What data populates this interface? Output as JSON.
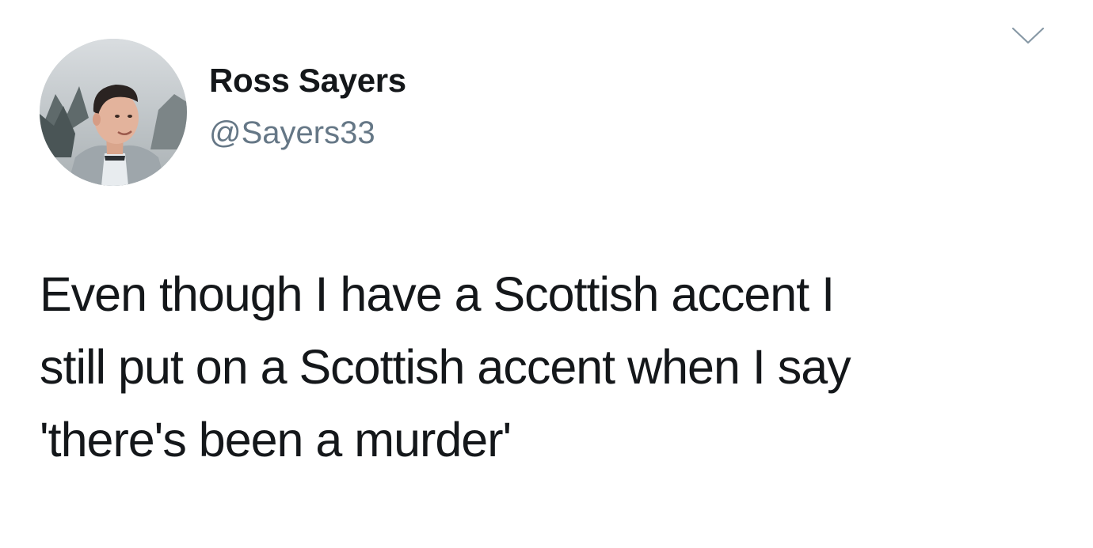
{
  "author": {
    "display_name": "Ross Sayers",
    "handle": "@Sayers33"
  },
  "tweet": {
    "lines": [
      "Even though I have a Scottish accent I",
      "still put on a Scottish accent when I say",
      "'there's been a murder'"
    ]
  },
  "icons": {
    "menu": "chevron-down-icon",
    "avatar": "profile-photo"
  },
  "colors": {
    "background": "#ffffff",
    "name": "#14171a",
    "handle": "#657786",
    "chevron": "#8899a6"
  }
}
